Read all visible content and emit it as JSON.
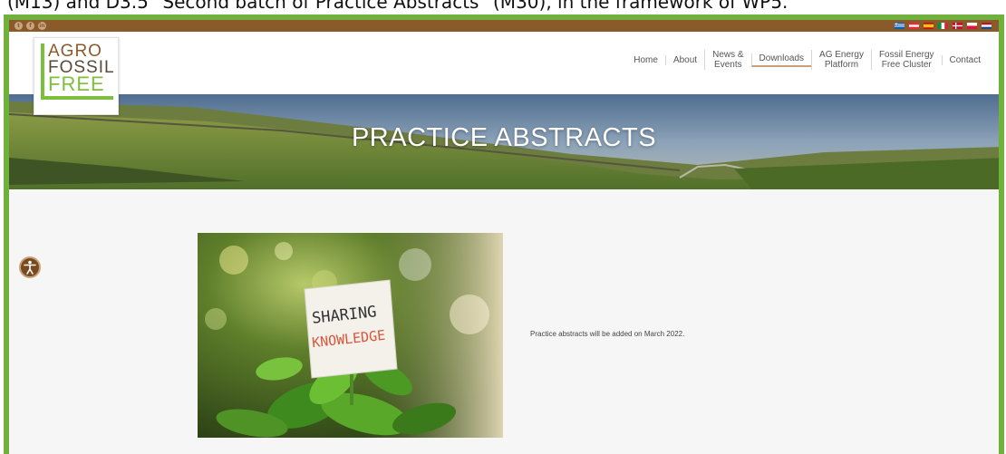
{
  "caption": "(M13) and D3.5 \"Second batch of Practice Abstracts\" (M30), in the framework of WP5.",
  "topbar": {
    "social": [
      "twitter-icon",
      "facebook-icon",
      "linkedin-icon"
    ],
    "flags": [
      "flag-gr",
      "flag-at",
      "flag-es",
      "flag-it",
      "flag-dk",
      "flag-pl",
      "flag-nl"
    ]
  },
  "logo": {
    "line1": "AGRO",
    "line2": "FOSSIL",
    "line3": "FREE"
  },
  "nav": [
    {
      "label": "Home"
    },
    {
      "label": "About"
    },
    {
      "label": "News &\nEvents"
    },
    {
      "label": "Downloads",
      "active": true
    },
    {
      "label": "AG Energy\nPlatform"
    },
    {
      "label": "Fossil Energy\nFree Cluster"
    },
    {
      "label": "Contact"
    }
  ],
  "hero": {
    "title": "PRACTICE ABSTRACTS"
  },
  "photo": {
    "line1": "SHARING",
    "line2": "KNOWLEDGE"
  },
  "content": {
    "notice": "Practice abstracts will be added on March 2022."
  },
  "colors": {
    "frame": "#6fb13b",
    "topbar": "#8b5a2b",
    "accent": "#7cbf3d",
    "active_underline": "#c8a07a"
  }
}
